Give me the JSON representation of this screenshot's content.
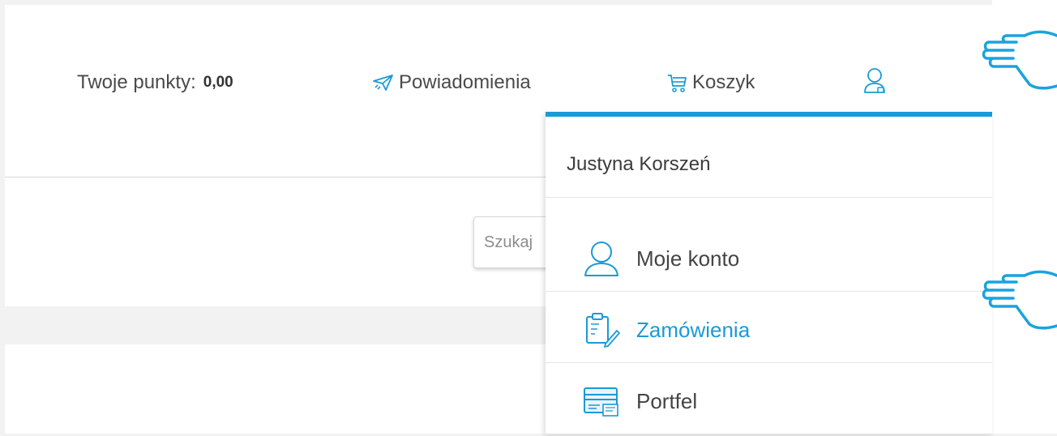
{
  "header": {
    "points_label": "Twoje punkty:",
    "points_value": "0,00",
    "notifications_label": "Powiadomienia",
    "cart_label": "Koszyk"
  },
  "search": {
    "placeholder": "Szukaj"
  },
  "user_menu": {
    "user_name": "Justyna Korszeń",
    "items": [
      {
        "label": "Moje konto",
        "icon": "user-icon",
        "active": false
      },
      {
        "label": "Zamówienia",
        "icon": "clipboard-edit-icon",
        "active": true
      },
      {
        "label": "Portfel",
        "icon": "wallet-card-icon",
        "active": false
      }
    ]
  },
  "colors": {
    "accent": "#1a9ad8",
    "text": "#444444",
    "pointer_hand": "#1aa3de"
  },
  "annotations": [
    {
      "icon": "pointing-hand-icon"
    },
    {
      "icon": "pointing-hand-icon"
    }
  ]
}
